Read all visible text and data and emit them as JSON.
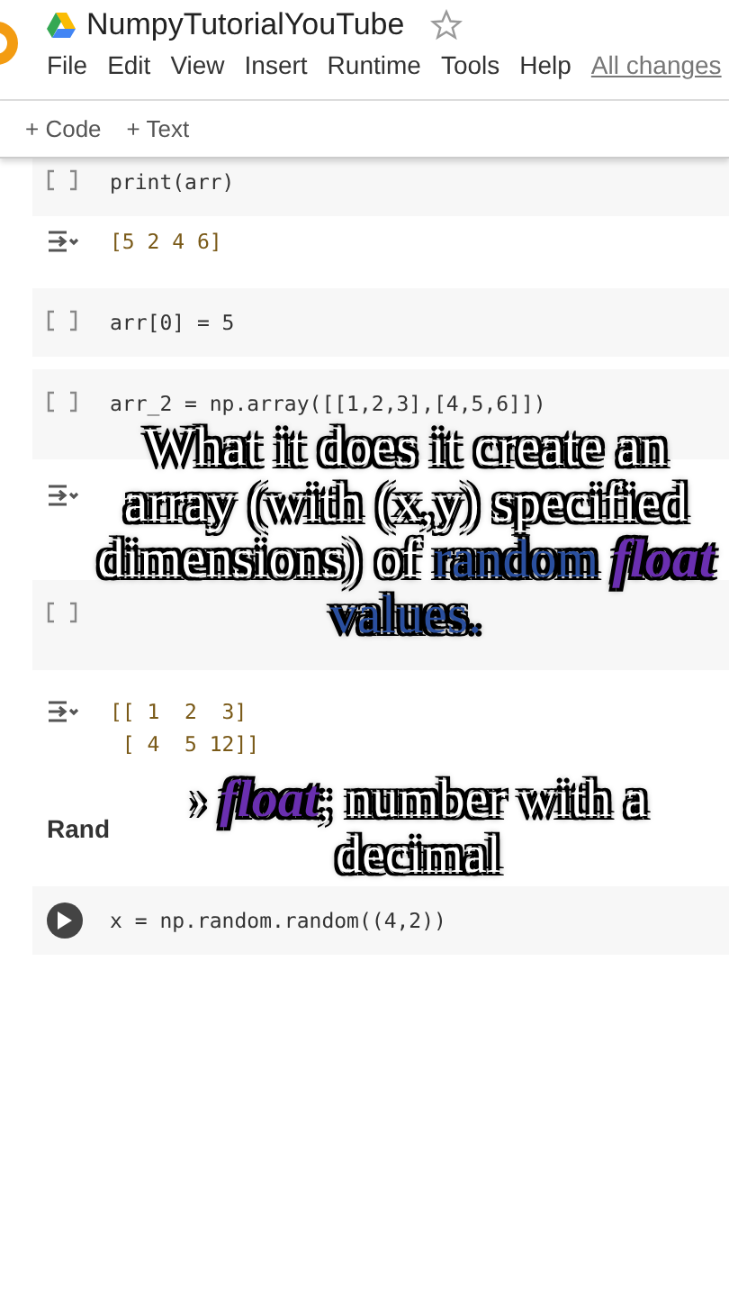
{
  "header": {
    "title": "NumpyTutorialYouTube",
    "starred": false,
    "menu": [
      "File",
      "Edit",
      "View",
      "Insert",
      "Runtime",
      "Tools",
      "Help"
    ],
    "save_status": "All changes"
  },
  "toolbar": [
    "+ Code",
    "+ Text"
  ],
  "cells": [
    {
      "kind": "code",
      "focused": false,
      "lines": [
        "print(arr)"
      ],
      "output_shown": true,
      "output_lines": [
        "[5 2 4 6]"
      ]
    },
    {
      "kind": "code",
      "focused": false,
      "lines": [
        "arr[0] = 5"
      ],
      "output_shown": false
    },
    {
      "kind": "code",
      "focused": false,
      "lines": [
        "arr_2 = np.array([[1,2,3],[4,5,6]])"
      ],
      "output_shown": true
    },
    {
      "kind": "code",
      "focused": false,
      "output_shown": true,
      "output_lines": [
        "[[ 1  2  3]",
        " [ 4  5 12]]"
      ]
    },
    {
      "kind": "heading",
      "text": "Rand"
    },
    {
      "kind": "code",
      "focused": true,
      "lines": [
        "x = np.random.random((4,2))"
      ],
      "output_shown": false
    }
  ],
  "caption": [
    {
      "text": "What it does it create an array (with (x,y) specified dimensions) of ",
      "kind": "plain"
    },
    {
      "text": "random ",
      "kind": "highlight"
    },
    {
      "text": "float",
      "kind": "term"
    },
    {
      "text": " values.",
      "kind": "highlight"
    }
  ],
  "note": [
    {
      "text": "› ",
      "kind": "plain"
    },
    {
      "text": "float",
      "kind": "term"
    },
    {
      "text": "; number with a decimal",
      "kind": "plain"
    }
  ]
}
